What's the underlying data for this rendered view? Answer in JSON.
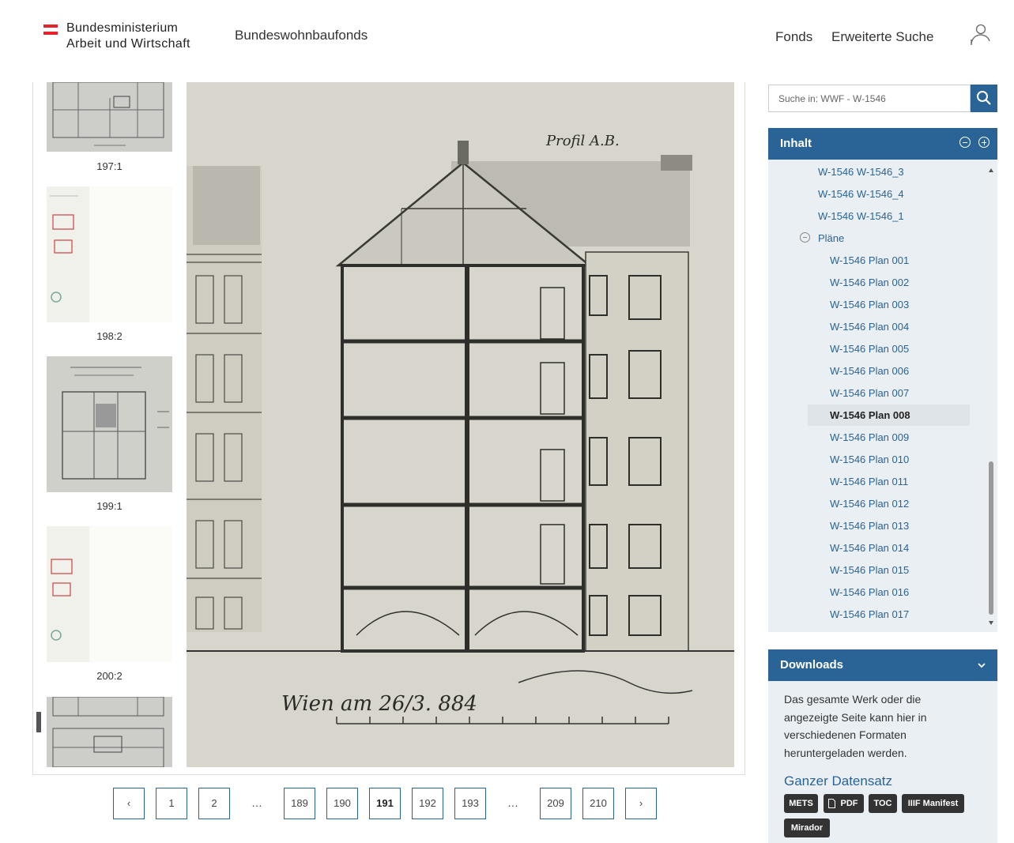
{
  "header": {
    "logo_line1": "Bundesministerium",
    "logo_line2": "Arbeit und Wirtschaft",
    "site_title": "Bundeswohnbaufonds",
    "nav": [
      "Fonds",
      "Erweiterte Suche"
    ]
  },
  "viewer": {
    "thumbnails": [
      "197:1",
      "198:2",
      "199:1",
      "200:2"
    ],
    "plan_handwriting": {
      "place_date": "Wien am 26/3. 884",
      "stamp_top": "Profil A.B."
    }
  },
  "pagination": {
    "prev": "‹",
    "next": "›",
    "pages": [
      "1",
      "2",
      "…",
      "189",
      "190",
      "191",
      "192",
      "193",
      "…",
      "209",
      "210"
    ],
    "active": "191"
  },
  "sidebar": {
    "search_placeholder": "Suche in: WWF - W-1546",
    "toc_title": "Inhalt",
    "toc_items": [
      "W-1546 W-1546_3",
      "W-1546 W-1546_4",
      "W-1546 W-1546_1"
    ],
    "toc_group": "Pläne",
    "plans": [
      "W-1546 Plan 001",
      "W-1546 Plan 002",
      "W-1546 Plan 003",
      "W-1546 Plan 004",
      "W-1546 Plan 005",
      "W-1546 Plan 006",
      "W-1546 Plan 007",
      "W-1546 Plan 008",
      "W-1546 Plan 009",
      "W-1546 Plan 010",
      "W-1546 Plan 011",
      "W-1546 Plan 012",
      "W-1546 Plan 013",
      "W-1546 Plan 014",
      "W-1546 Plan 015",
      "W-1546 Plan 016",
      "W-1546 Plan 017"
    ],
    "selected_plan": "W-1546 Plan 008",
    "downloads_title": "Downloads",
    "downloads_text": "Das gesamte Werk oder die angezeigte Seite kann hier in verschiedenen Formaten heruntergeladen werden.",
    "downloads_subtitle": "Ganzer Datensatz",
    "download_buttons": [
      "METS",
      "PDF",
      "TOC",
      "IIIF Manifest",
      "Mirador"
    ]
  },
  "colors": {
    "accent": "#2a6496",
    "panel_bg": "#eaeff3",
    "flag_red": "#e3242b"
  }
}
